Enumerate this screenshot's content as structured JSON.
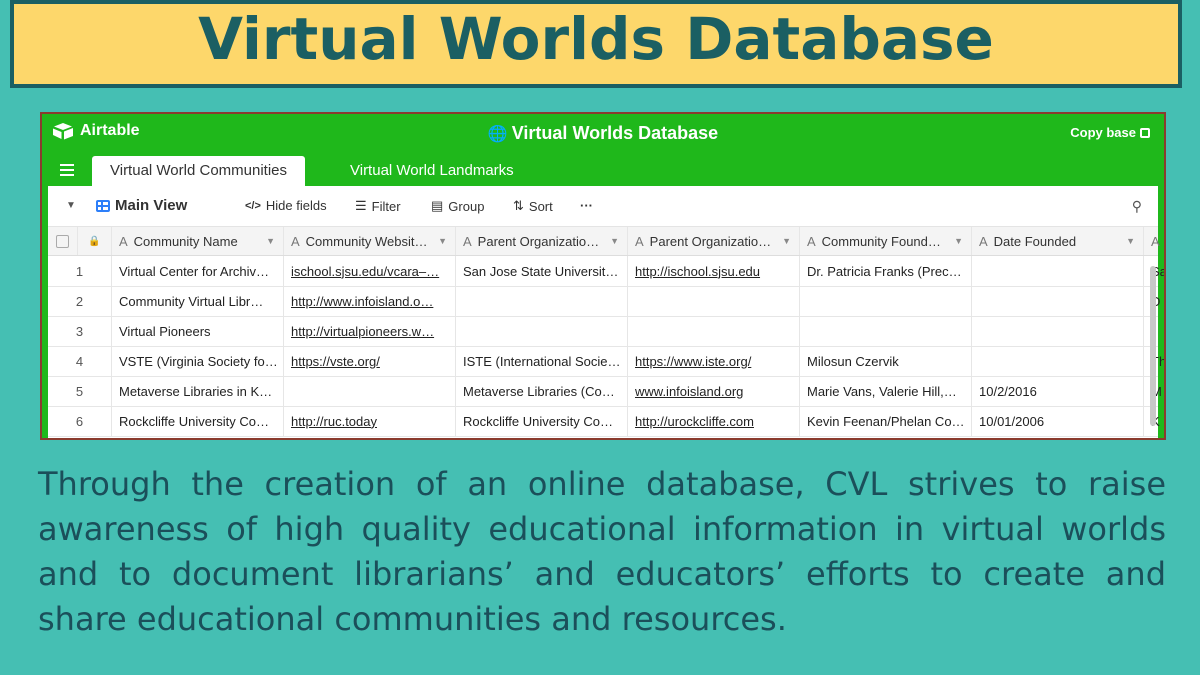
{
  "banner": {
    "title": "Virtual Worlds Database"
  },
  "app": {
    "logo_text": "Airtable",
    "base_title": "Virtual Worlds Database",
    "copy_base": "Copy base",
    "tabs": [
      "Virtual World Communities",
      "Virtual World Landmarks"
    ],
    "active_tab": 0
  },
  "toolbar": {
    "view_name": "Main View",
    "hide_fields": "Hide fields",
    "filter": "Filter",
    "group": "Group",
    "sort": "Sort",
    "more": "···"
  },
  "table": {
    "columns": [
      "Community Name",
      "Community Websit…",
      "Parent Organizatio…",
      "Parent Organizatio…",
      "Community Found…",
      "Date Founded"
    ],
    "rows": [
      {
        "num": "1",
        "cells": [
          "Virtual Center for Archiv…",
          "ischool.sjsu.edu/vcara–…",
          "San Jose State Universit…",
          "http://ischool.sjsu.edu",
          "Dr. Patricia Franks (Prec…",
          "",
          "Sa"
        ]
      },
      {
        "num": "2",
        "cells": [
          "Community Virtual Libr…",
          "http://www.infoisland.o…",
          "",
          "",
          "",
          "",
          "D"
        ]
      },
      {
        "num": "3",
        "cells": [
          "Virtual Pioneers",
          "http://virtualpioneers.w…",
          "",
          "",
          "",
          "",
          ""
        ]
      },
      {
        "num": "4",
        "cells": [
          "VSTE (Virginia Society fo…",
          "https://vste.org/",
          "ISTE (International Socie…",
          "https://www.iste.org/",
          "Milosun Czervik",
          "",
          "Th"
        ]
      },
      {
        "num": "5",
        "cells": [
          "Metaverse Libraries in K…",
          "",
          "Metaverse Libraries (Co…",
          "www.infoisland.org",
          "Marie Vans, Valerie Hill,…",
          "10/2/2016",
          "M"
        ]
      },
      {
        "num": "6",
        "cells": [
          "Rockcliffe University Co…",
          "http://ruc.today",
          "Rockcliffe University Co…",
          "http://urockcliffe.com",
          "Kevin Feenan/Phelan Co…",
          "10/01/2006",
          "K"
        ]
      }
    ]
  },
  "caption": "Through the creation of an online database, CVL strives to raise awareness of high quality educational information in virtual worlds and to document librarians’ and educators’ efforts to create and share educational communities and resources.",
  "colors": {
    "background": "#45bfb3",
    "banner": "#fdd76b",
    "banner_text": "#1b5f63",
    "airtable_green": "#1fb81b"
  },
  "icons": [
    "airtable-logo-icon",
    "globe-icon",
    "copy-icon",
    "menu-icon",
    "grid-view-icon",
    "hide-fields-icon",
    "filter-icon",
    "group-icon",
    "sort-icon",
    "search-icon",
    "text-field-icon"
  ]
}
